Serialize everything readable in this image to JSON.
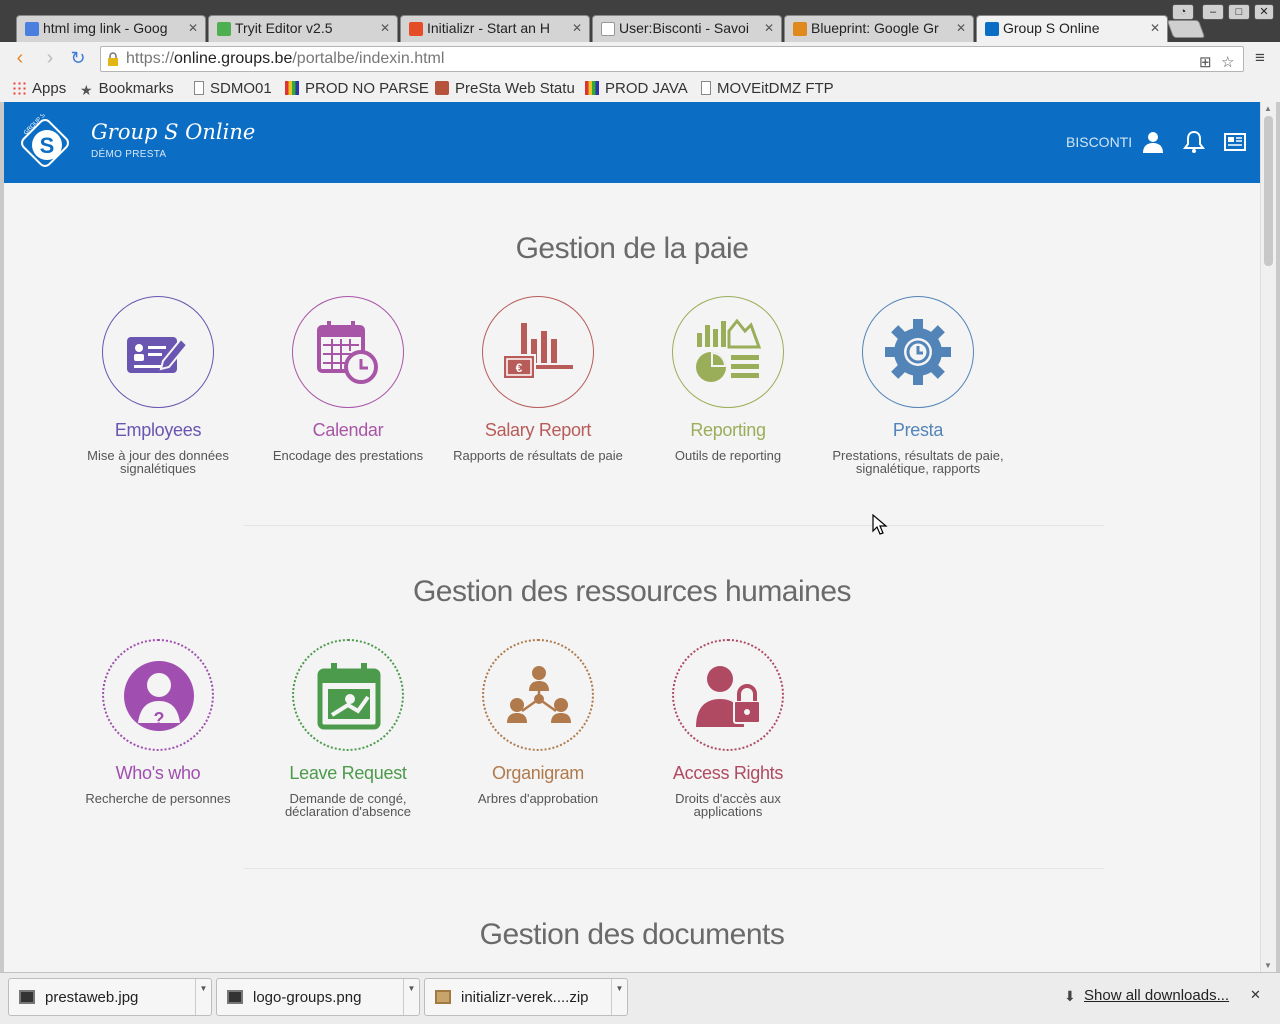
{
  "browser": {
    "tabs": [
      {
        "title": "html img link - Goog",
        "favicon_color": "#4a7fe0"
      },
      {
        "title": "Tryit Editor v2.5",
        "favicon_color": "#4caf50"
      },
      {
        "title": "Initializr - Start an H",
        "favicon_color": "#e44d26"
      },
      {
        "title": "User:Bisconti - Savoi",
        "favicon_color": "#ffffff"
      },
      {
        "title": "Blueprint: Google Gr",
        "favicon_color": "#e08a1e"
      },
      {
        "title": "Group S Online",
        "favicon_color": "#0b6ec4"
      }
    ],
    "url": {
      "scheme": "https://",
      "host": "online.groups.be",
      "path": "/portalbe/indexin.html"
    },
    "bookmarks": [
      {
        "label": "Apps",
        "icon": "apps-grid-icon"
      },
      {
        "label": "Bookmarks",
        "icon": "star-icon"
      },
      {
        "label": "SDMO01",
        "icon": "page-icon"
      },
      {
        "label": "PROD NO PARSE",
        "icon": "bars-icon"
      },
      {
        "label": "PreSta Web Statu",
        "icon": "bricks-icon"
      },
      {
        "label": "PROD JAVA",
        "icon": "bars-icon"
      },
      {
        "label": "MOVEitDMZ FTP",
        "icon": "page-icon"
      }
    ]
  },
  "header": {
    "title": "Group S Online",
    "subtitle": "DÉMO PRESTA",
    "user": "BISCONTI",
    "logo_text": "GROUP S",
    "brand_color": "#0b6ec4"
  },
  "sections": [
    {
      "title": "Gestion de la paie",
      "tiles": [
        {
          "name": "Employees",
          "desc": "Mise à jour des données signalétiques",
          "color": "#6a55b0",
          "icon": "employee-edit-icon"
        },
        {
          "name": "Calendar",
          "desc": "Encodage des prestations",
          "color": "#a855a8",
          "icon": "calendar-clock-icon"
        },
        {
          "name": "Salary Report",
          "desc": "Rapports de résultats de paie",
          "color": "#b85c5a",
          "icon": "salary-chart-icon"
        },
        {
          "name": "Reporting",
          "desc": "Outils de reporting",
          "color": "#9aae5a",
          "icon": "reporting-charts-icon"
        },
        {
          "name": "Presta",
          "desc": "Prestations, résultats de paie, signalétique, rapports",
          "color": "#5384b8",
          "icon": "gear-clock-icon"
        }
      ]
    },
    {
      "title": "Gestion des ressources humaines",
      "tiles": [
        {
          "name": "Who's who",
          "desc": "Recherche de personnes",
          "color": "#a04fb0",
          "icon": "person-question-icon"
        },
        {
          "name": "Leave Request",
          "desc": "Demande de congé, déclaration d'absence",
          "color": "#4c9a4c",
          "icon": "calendar-leave-icon"
        },
        {
          "name": "Organigram",
          "desc": "Arbres d'approbation",
          "color": "#b07a4c",
          "icon": "org-tree-icon"
        },
        {
          "name": "Access Rights",
          "desc": "Droits d'accès aux applications",
          "color": "#b04a62",
          "icon": "person-lock-icon"
        }
      ]
    },
    {
      "title": "Gestion des documents",
      "tiles": []
    }
  ],
  "downloads": {
    "items": [
      {
        "name": "prestaweb.jpg"
      },
      {
        "name": "logo-groups.png"
      },
      {
        "name": "initializr-verek....zip"
      }
    ],
    "show_all": "Show all downloads..."
  }
}
